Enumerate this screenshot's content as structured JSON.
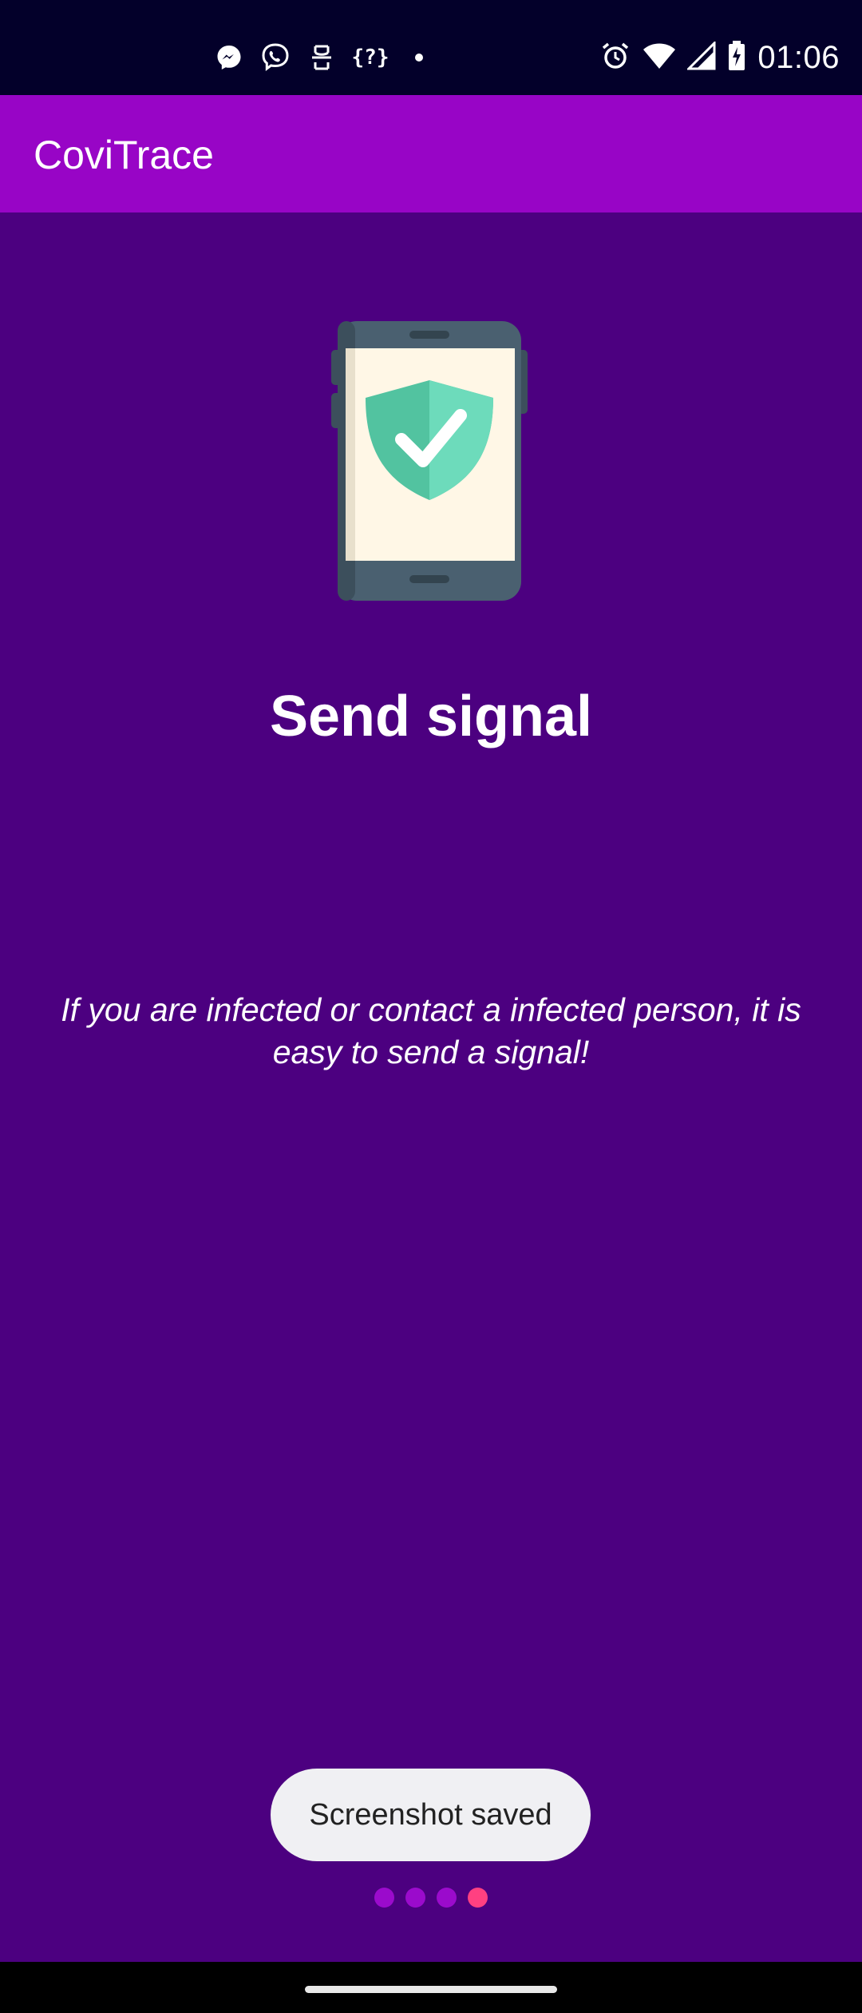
{
  "status_bar": {
    "time": "01:06",
    "notification_icons": [
      "messenger-icon",
      "viber-icon",
      "app-icon",
      "code-icon",
      "dot-icon"
    ],
    "system_icons": [
      "alarm-icon",
      "wifi-icon",
      "signal-icon",
      "battery-charging-icon"
    ]
  },
  "app_bar": {
    "title": "CoviTrace"
  },
  "onboarding": {
    "illustration": "phone-shield-check-icon",
    "title": "Send signal",
    "description": "If you are infected or contact a infected person, it is easy to send a signal!",
    "page_count": 4,
    "current_page": 4
  },
  "toast": {
    "message": "Screenshot saved"
  },
  "colors": {
    "background": "#4c0080",
    "app_bar": "#9805c6",
    "status_bar": "#03002a",
    "dot_inactive": "#9b0bcc",
    "dot_active": "#ff4081"
  }
}
